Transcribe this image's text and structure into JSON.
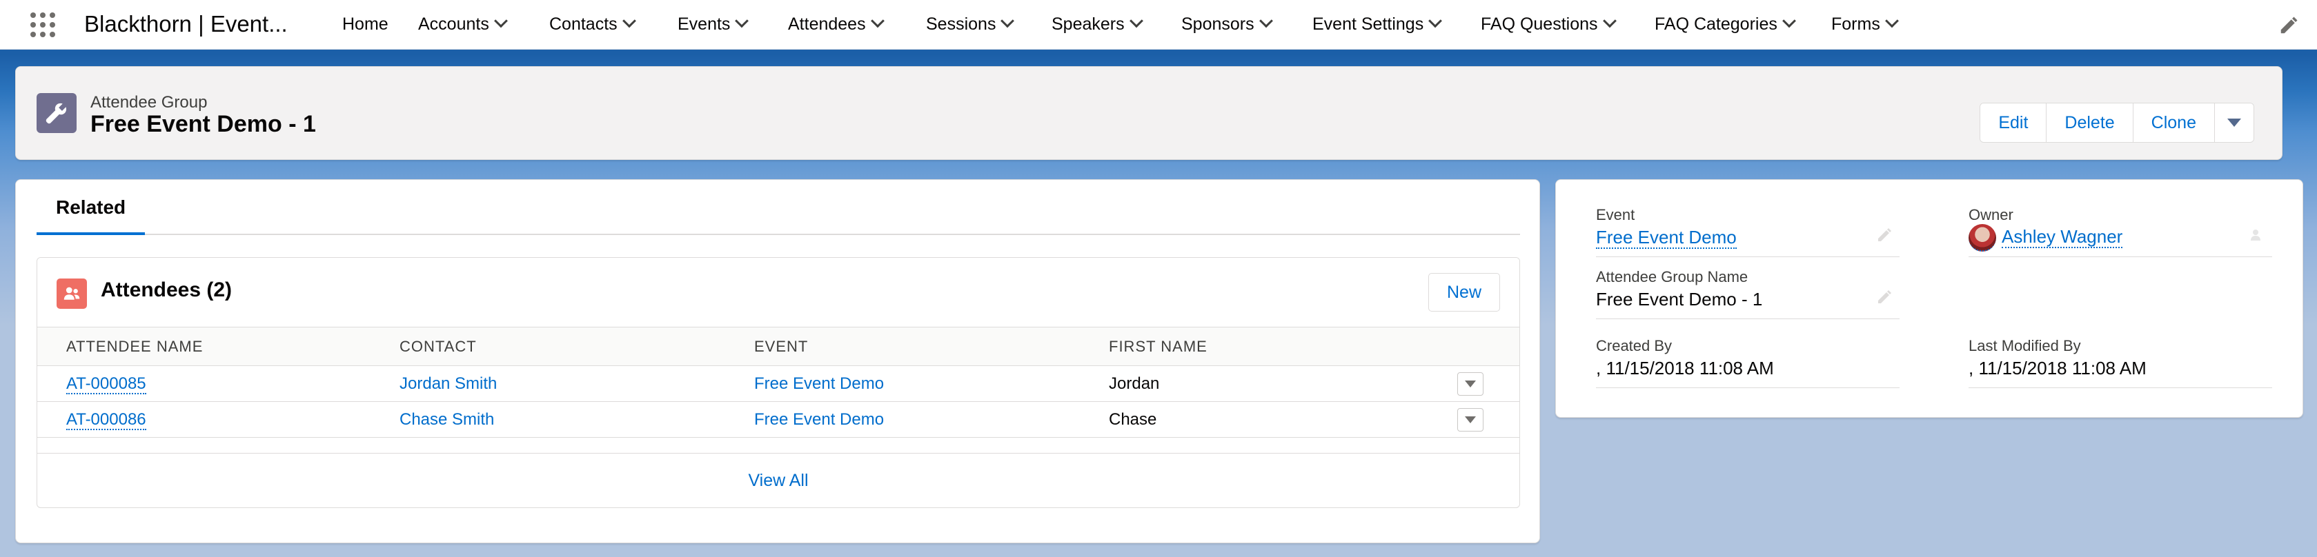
{
  "app": {
    "name": "Blackthorn | Event..."
  },
  "nav": {
    "items": [
      {
        "label": "Home",
        "has_menu": false
      },
      {
        "label": "Accounts",
        "has_menu": true
      },
      {
        "label": "Contacts",
        "has_menu": true
      },
      {
        "label": "Events",
        "has_menu": true
      },
      {
        "label": "Attendees",
        "has_menu": true
      },
      {
        "label": "Sessions",
        "has_menu": true
      },
      {
        "label": "Speakers",
        "has_menu": true
      },
      {
        "label": "Sponsors",
        "has_menu": true
      },
      {
        "label": "Event Settings",
        "has_menu": true
      },
      {
        "label": "FAQ Questions",
        "has_menu": true
      },
      {
        "label": "FAQ Categories",
        "has_menu": true
      },
      {
        "label": "Forms",
        "has_menu": true
      }
    ]
  },
  "record": {
    "object_type": "Attendee Group",
    "title": "Free Event Demo - 1",
    "actions": {
      "edit": "Edit",
      "delete": "Delete",
      "clone": "Clone"
    }
  },
  "tabs": {
    "related": "Related"
  },
  "related_list": {
    "title": "Attendees (2)",
    "new_label": "New",
    "columns": [
      "ATTENDEE NAME",
      "CONTACT",
      "EVENT",
      "FIRST NAME"
    ],
    "rows": [
      {
        "attendee_name": "AT-000085",
        "contact": "Jordan Smith",
        "event": "Free Event Demo",
        "first_name": "Jordan"
      },
      {
        "attendee_name": "AT-000086",
        "contact": "Chase Smith",
        "event": "Free Event Demo",
        "first_name": "Chase"
      }
    ],
    "view_all": "View All"
  },
  "details": {
    "event": {
      "label": "Event",
      "value": "Free Event Demo"
    },
    "owner": {
      "label": "Owner",
      "value": "Ashley Wagner"
    },
    "group_name": {
      "label": "Attendee Group Name",
      "value": "Free Event Demo - 1"
    },
    "created_by": {
      "label": "Created By",
      "value": ", 11/15/2018 11:08 AM"
    },
    "last_modified_by": {
      "label": "Last Modified By",
      "value": ", 11/15/2018 11:08 AM"
    }
  },
  "colors": {
    "link": "#006dcc",
    "brand_band": "#1b5fa8",
    "attendee_icon": "#ef6e64",
    "record_icon": "#706e8f"
  }
}
